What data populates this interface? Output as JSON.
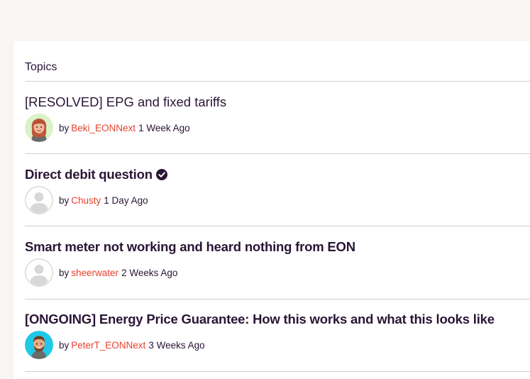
{
  "section": {
    "title": "Topics"
  },
  "topics": [
    {
      "title": "[RESOLVED] EPG and fixed tariffs",
      "by_label": "by",
      "author": "Beki_EONNext",
      "time": "1 Week Ago",
      "avatar": "female-avatar-icon"
    },
    {
      "title": "Direct debit question",
      "by_label": "by",
      "author": "Chusty",
      "time": "1 Day Ago",
      "avatar": "default-user-icon",
      "solved": true
    },
    {
      "title": "Smart meter not working and heard nothing from EON",
      "by_label": "by",
      "author": "sheerwater",
      "time": "2 Weeks Ago",
      "avatar": "default-user-icon"
    },
    {
      "title": "[ONGOING] Energy Price Guarantee: How this works and what this looks like",
      "by_label": "by",
      "author": "PeterT_EONNext",
      "time": "3 Weeks Ago",
      "avatar": "male-avatar-icon"
    }
  ],
  "colors": {
    "page_background": "#f8f5f3",
    "text": "#2a1536",
    "author_link": "#e8412c",
    "divider": "#cfcfcf"
  }
}
